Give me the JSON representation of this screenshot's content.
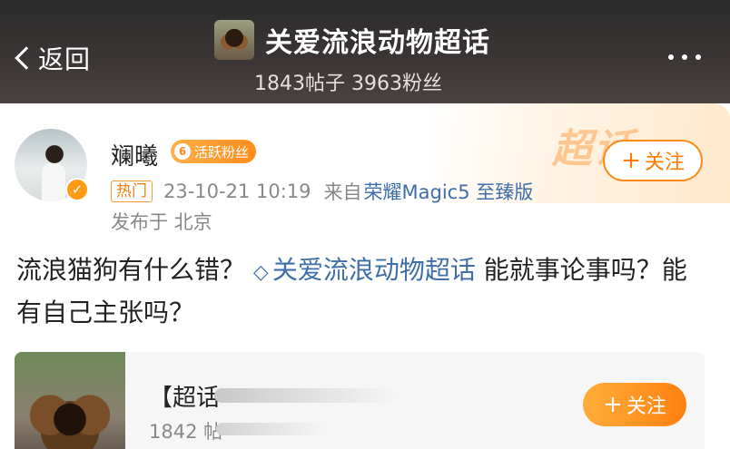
{
  "header": {
    "back_label": "返回",
    "title": "关爱流浪动物超话",
    "stats": "1843帖子 3963粉丝",
    "more_icon": "more-icon"
  },
  "post": {
    "watermark": "超话",
    "username": "斓曦",
    "fan_badge": {
      "level": "6",
      "label": "活跃粉丝"
    },
    "follow_label": "关注",
    "hot_tag": "热门",
    "timestamp": "23-10-21 10:19",
    "source_prefix": "来自",
    "source_device": "荣耀Magic5 至臻版",
    "location": "发布于 北京",
    "text_before": "流浪猫狗有什么错？",
    "topic": "关爱流浪动物超话",
    "text_after": " 能就事论事吗？能有自己主张吗？"
  },
  "embed": {
    "title": "【超话",
    "sub": "1842 帖",
    "follow_label": "关注"
  },
  "colors": {
    "accent": "#ff8a1a",
    "link": "#3f6ea8"
  }
}
